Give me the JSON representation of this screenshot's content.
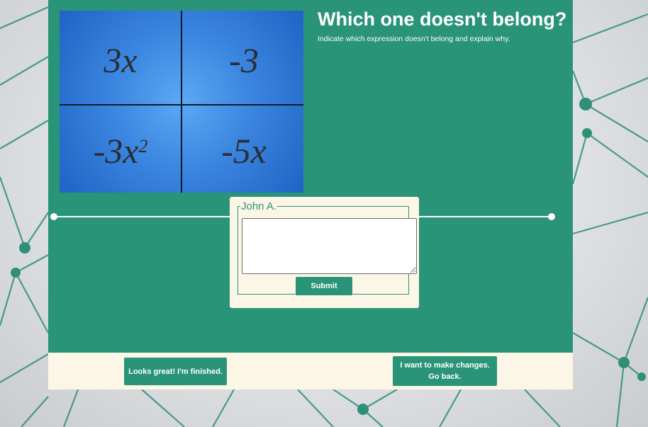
{
  "puzzle": {
    "expressions": [
      {
        "base": "3x",
        "sup": ""
      },
      {
        "base": "-3",
        "sup": ""
      },
      {
        "base": "-3x",
        "sup": "2"
      },
      {
        "base": "-5x",
        "sup": ""
      }
    ]
  },
  "header": {
    "title": "Which one doesn't belong?",
    "instructions": "Indicate which expression doesn't belong and explain why."
  },
  "response": {
    "student_name": "John A.",
    "answer_value": "",
    "submit_label": "Submit"
  },
  "footer": {
    "finished_label": "Looks great! I'm finished.",
    "change_label": "I want to make changes. Go back."
  },
  "colors": {
    "panel": "#2a9478",
    "footer": "#fcf6e6",
    "button": "#2a9478",
    "puzzle_blue": "#3b86e0"
  }
}
